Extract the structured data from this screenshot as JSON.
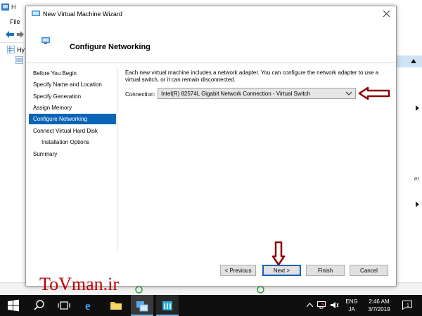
{
  "background_app": {
    "title": "H",
    "menu_file": "File",
    "tree_label": "Hy",
    "right_panel": {
      "side_letter": "er"
    }
  },
  "dialog": {
    "title": "New Virtual Machine Wizard",
    "header_title": "Configure Networking",
    "nav_items": [
      {
        "label": "Before You Begin",
        "active": false,
        "sub": false
      },
      {
        "label": "Specify Name and Location",
        "active": false,
        "sub": false
      },
      {
        "label": "Specify Generation",
        "active": false,
        "sub": false
      },
      {
        "label": "Assign Memory",
        "active": false,
        "sub": false
      },
      {
        "label": "Configure Networking",
        "active": true,
        "sub": false
      },
      {
        "label": "Connect Virtual Hard Disk",
        "active": false,
        "sub": false
      },
      {
        "label": "Installation Options",
        "active": false,
        "sub": true
      },
      {
        "label": "Summary",
        "active": false,
        "sub": false
      }
    ],
    "description": "Each new virtual machine includes a network adapter. You can configure the network adapter to use a virtual switch, or it can remain disconnected.",
    "connection_label": "Connection:",
    "connection_value": "Intel(R) 82574L Gigabit Network Connection - Virtual Switch",
    "buttons": {
      "previous": "< Previous",
      "next": "Next >",
      "finish": "Finish",
      "cancel": "Cancel"
    }
  },
  "watermark": "ToVman.ir",
  "taskbar": {
    "language_line1": "ENG",
    "language_line2": "JA",
    "time": "2:46 AM",
    "date": "3/7/2019",
    "notification_count": "1"
  },
  "colors": {
    "accent": "#0a64b8",
    "annotation": "#8b0000",
    "watermark": "#c00000",
    "taskbar": "#0f0f0f"
  }
}
